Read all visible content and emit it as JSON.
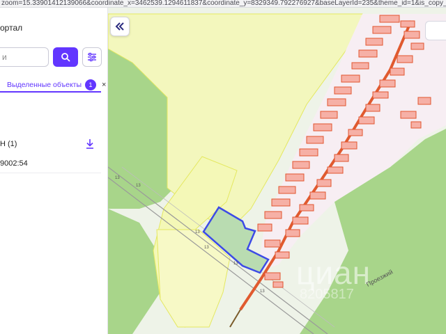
{
  "browser": {
    "url_fragment": "zoom=15.33901412139066&coordinate_x=3462539.1294611837&coordinate_y=8329349.792276927&baseLayerId=235&theme_id=1&is_copy_url=true"
  },
  "panel": {
    "title": "ортал",
    "search_placeholder": "и",
    "search_icon": "search-icon",
    "filter_icon": "sliders-icon",
    "tab": {
      "label": "Выделенные объекты",
      "count": "1",
      "close": "×"
    },
    "group_label": "Н (1)",
    "download_icon": "download-icon",
    "parcel_number": "9002:54"
  },
  "map": {
    "collapse_icon": "double-chevron-left-icon",
    "watermark": "циан",
    "watermark_number": "8205817",
    "street_label": "Проезжий",
    "numbers": [
      "13",
      "13",
      "13",
      "13",
      "13",
      "13"
    ],
    "colors": {
      "forest": "#a8d58a",
      "zone_yellow": "#f3f7bd",
      "zone_yellow_border": "#e4e860",
      "buildings": "#f6b0a6",
      "building_border": "#e2552f",
      "selected_fill": "#b9dcb1",
      "selected_border": "#3d4be6",
      "road": "#e05a2f",
      "accent": "#6236ff"
    }
  }
}
